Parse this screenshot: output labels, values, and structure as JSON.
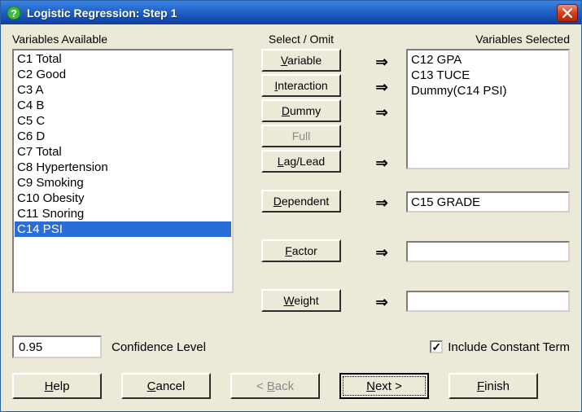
{
  "window": {
    "title": "Logistic Regression: Step 1"
  },
  "labels": {
    "available": "Variables Available",
    "select_omit": "Select / Omit",
    "selected": "Variables Selected",
    "confidence": "Confidence Level"
  },
  "buttons": {
    "variable": "Variable",
    "interaction": "Interaction",
    "dummy": "Dummy",
    "full": "Full",
    "laglead": "Lag/Lead",
    "dependent": "Dependent",
    "factor": "Factor",
    "weight": "Weight",
    "help": "Help",
    "cancel": "Cancel",
    "back": "< Back",
    "next": "Next >",
    "finish": "Finish"
  },
  "underline": {
    "variable": "V",
    "interaction": "I",
    "dummy": "D",
    "laglead": "L",
    "dependent": "D",
    "factor": "F",
    "weight": "W",
    "help": "H",
    "cancel": "C",
    "back": "B",
    "next": "N",
    "finish": "F"
  },
  "available": {
    "items": [
      "C1 Total",
      "C2 Good",
      "C3 A",
      "C4 B",
      "C5 C",
      "C6 D",
      "C7 Total",
      "C8 Hypertension",
      "C9 Smoking",
      "C10 Obesity",
      "C11 Snoring",
      "C14 PSI"
    ],
    "selected_index": 11
  },
  "selected": {
    "items": [
      "C12 GPA",
      "C13 TUCE",
      "Dummy(C14 PSI)"
    ]
  },
  "dependent": "C15 GRADE",
  "factor": "",
  "weight": "",
  "confidence": "0.95",
  "include_constant": {
    "label": "Include Constant Term",
    "checked": true
  },
  "arrows": {
    "right": "⇒"
  }
}
